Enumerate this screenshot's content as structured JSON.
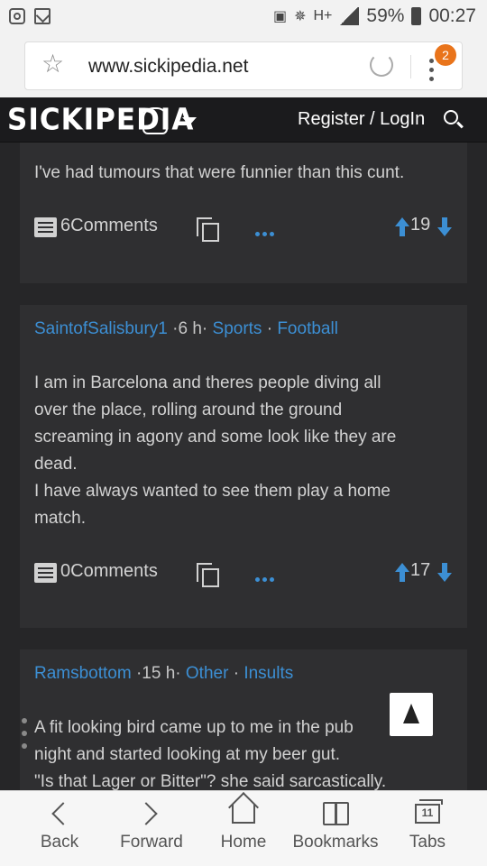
{
  "status_bar": {
    "battery": "59%",
    "time": "00:27",
    "network": "H+"
  },
  "browser": {
    "url": "www.sickipedia.net",
    "tabs_badge": "2"
  },
  "site": {
    "logo": "SICKIPEDIA",
    "register_login": "Register / LogIn"
  },
  "posts": [
    {
      "body": "I've had tumours that were funnier than this cunt.",
      "comments": "6Comments",
      "votes": "19"
    },
    {
      "author": "SaintofSalisbury1",
      "time": "·6 h·",
      "category": "Sports",
      "sep": "·",
      "subcategory": "Football",
      "body_lines": [
        "I am in Barcelona and theres people diving all",
        "over the place, rolling around the ground",
        "screaming in agony and some look like they are",
        "dead.",
        "I have always wanted to see them play a home",
        "match."
      ],
      "comments": "0Comments",
      "votes": "17"
    },
    {
      "author": "Ramsbottom",
      "time": "·15 h·",
      "category": "Other",
      "sep": "·",
      "subcategory": "Insults",
      "body_lines": [
        "A fit looking bird came up to me in the pub",
        "night and started looking at my beer gut.",
        "\"Is that Lager or Bitter\"? she said sarcastically."
      ]
    }
  ],
  "bottom_nav": {
    "back": "Back",
    "forward": "Forward",
    "home": "Home",
    "bookmarks": "Bookmarks",
    "tabs": "Tabs",
    "tabs_count": "11"
  }
}
